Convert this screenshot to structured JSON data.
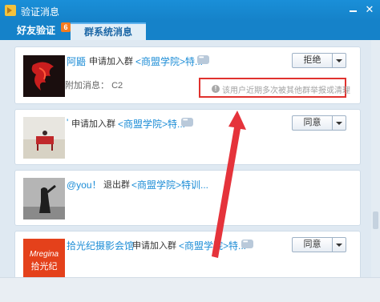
{
  "window": {
    "title": "验证消息"
  },
  "tabs": [
    {
      "label": "好友验证",
      "badge": "6"
    },
    {
      "label": "群系统消息"
    }
  ],
  "items": [
    {
      "name": "阿鼯",
      "action": "申请加入群",
      "group": "<商盟学院>特...",
      "button": "拒绝",
      "extra_label": "附加消息：",
      "extra_value": "C2",
      "warning": "该用户近期多次被其他群举报或清理"
    },
    {
      "name": "'",
      "action": "申请加入群",
      "group": "<商盟学院>特...",
      "button": "同意"
    },
    {
      "name": "@you！",
      "action": "退出群",
      "group": "<商盟学院>特训..."
    },
    {
      "name": "拾光纪摄影会馆",
      "action": "申请加入群",
      "group": "<商盟学院>特...",
      "button": "同意",
      "avatar_text_top": "Mregina",
      "avatar_text_bottom": "拾光纪"
    }
  ],
  "colors": {
    "accent": "#1582c9",
    "link": "#1b8cd6",
    "warning_border": "#e0322e",
    "arrow": "#e5333b"
  }
}
